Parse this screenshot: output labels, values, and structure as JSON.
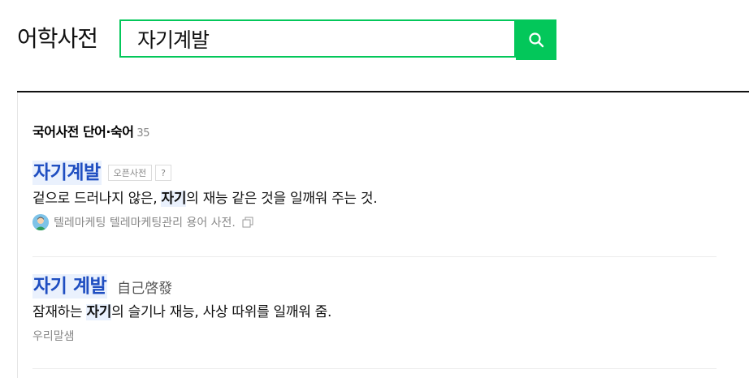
{
  "header": {
    "title": "어학사전"
  },
  "search": {
    "value": "자기계발",
    "icon": "search-icon",
    "accent": "#03c75a"
  },
  "results": {
    "section_title": "국어사전 단어·숙어",
    "count": "35",
    "entries": [
      {
        "headword": "자기계발",
        "tags": [
          "오픈사전",
          "?"
        ],
        "definition_before": "겉으로 드러나지 않은, ",
        "definition_highlight": "자기",
        "definition_after": "의 재능 같은 것을 일깨워 주는 것.",
        "source": "텔레마케팅 텔레마케팅관리 용어 사전.",
        "source_icon": "user-avatar-icon",
        "copy_icon": "copy-icon"
      },
      {
        "headword": "자기 계발",
        "hanja": "自己啓發",
        "definition_before": "잠재하는 ",
        "definition_highlight": "자기",
        "definition_after": "의 슬기나 재능, 사상 따위를 일깨워 줌.",
        "source": "우리말샘"
      }
    ]
  },
  "colors": {
    "headword": "#1f4ec1",
    "highlight_bg": "#eaf1fd"
  }
}
